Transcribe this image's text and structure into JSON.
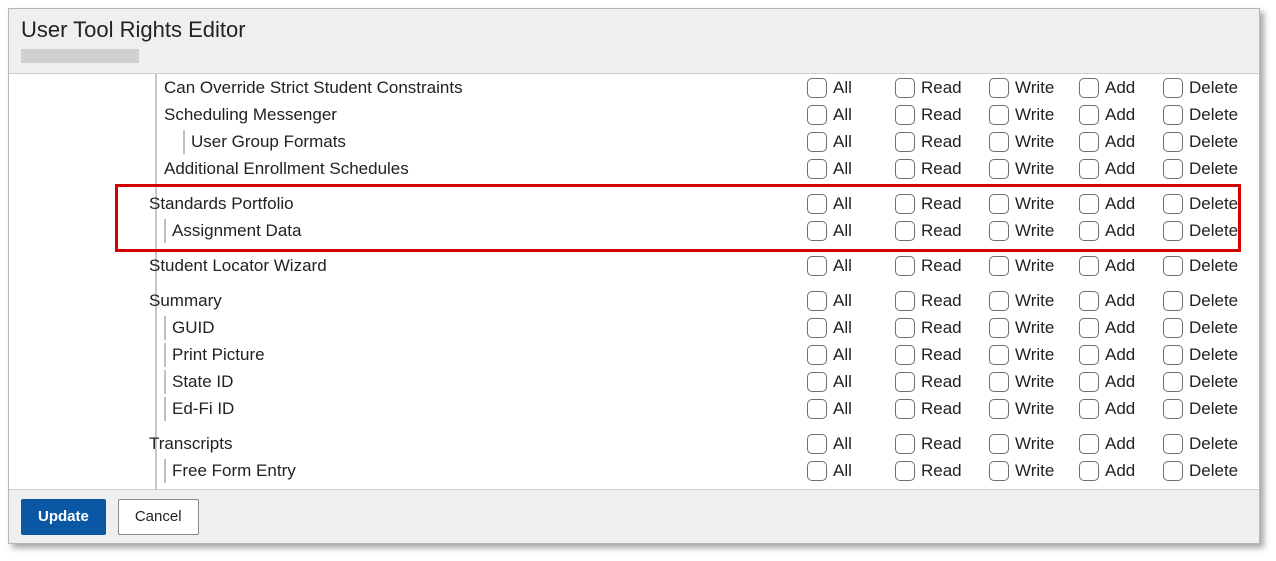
{
  "header": {
    "title": "User Tool Rights Editor"
  },
  "columns": {
    "all": "All",
    "read": "Read",
    "write": "Write",
    "add": "Add",
    "delete": "Delete"
  },
  "rows": [
    {
      "label": "Can Override Strict Student Constraints",
      "level": 1,
      "bar": false
    },
    {
      "label": "Scheduling Messenger",
      "level": 1,
      "bar": false
    },
    {
      "label": "User Group Formats",
      "level": 2,
      "bar": true
    },
    {
      "label": "Additional Enrollment Schedules",
      "level": 1,
      "bar": false
    },
    {
      "spacer": true
    },
    {
      "label": "Standards Portfolio",
      "level": 0,
      "bar": false,
      "highlight": true
    },
    {
      "label": "Assignment Data",
      "level": 1,
      "bar": true,
      "highlight": true
    },
    {
      "spacer": true
    },
    {
      "label": "Student Locator Wizard",
      "level": 0,
      "bar": false
    },
    {
      "spacer": true
    },
    {
      "label": "Summary",
      "level": 0,
      "bar": false
    },
    {
      "label": "GUID",
      "level": 1,
      "bar": true
    },
    {
      "label": "Print Picture",
      "level": 1,
      "bar": true
    },
    {
      "label": "State ID",
      "level": 1,
      "bar": true
    },
    {
      "label": "Ed-Fi ID",
      "level": 1,
      "bar": true
    },
    {
      "spacer": true
    },
    {
      "label": "Transcripts",
      "level": 0,
      "bar": false
    },
    {
      "label": "Free Form Entry",
      "level": 1,
      "bar": true
    }
  ],
  "footer": {
    "update": "Update",
    "cancel": "Cancel"
  }
}
